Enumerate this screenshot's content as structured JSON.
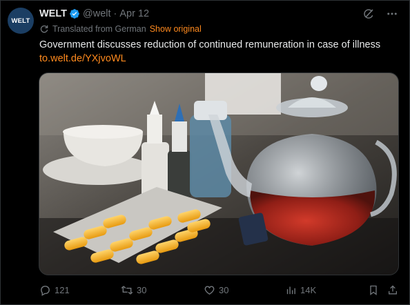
{
  "account": {
    "avatar_text": "WELT",
    "name": "WELT",
    "handle": "@welt",
    "separator": "·",
    "date": "Apr 12"
  },
  "translation": {
    "note": "Translated from German",
    "show_original": "Show original"
  },
  "tweet": {
    "text": "Government discusses reduction of continued remuneration in case of illness",
    "link": "to.welt.de/YXjvoWL"
  },
  "actions": {
    "replies": "121",
    "reposts": "30",
    "likes": "30",
    "views": "14K"
  },
  "colors": {
    "accent_link": "#ff8a1e",
    "muted": "#71767b",
    "text": "#e7e9ea",
    "verified": "#1d9bf0",
    "avatar_bg": "#1b3e63"
  },
  "icons": [
    "verified-badge-icon",
    "grok-icon",
    "more-icon",
    "translate-icon",
    "reply-icon",
    "repost-icon",
    "like-icon",
    "views-icon",
    "bookmark-icon",
    "share-icon"
  ]
}
